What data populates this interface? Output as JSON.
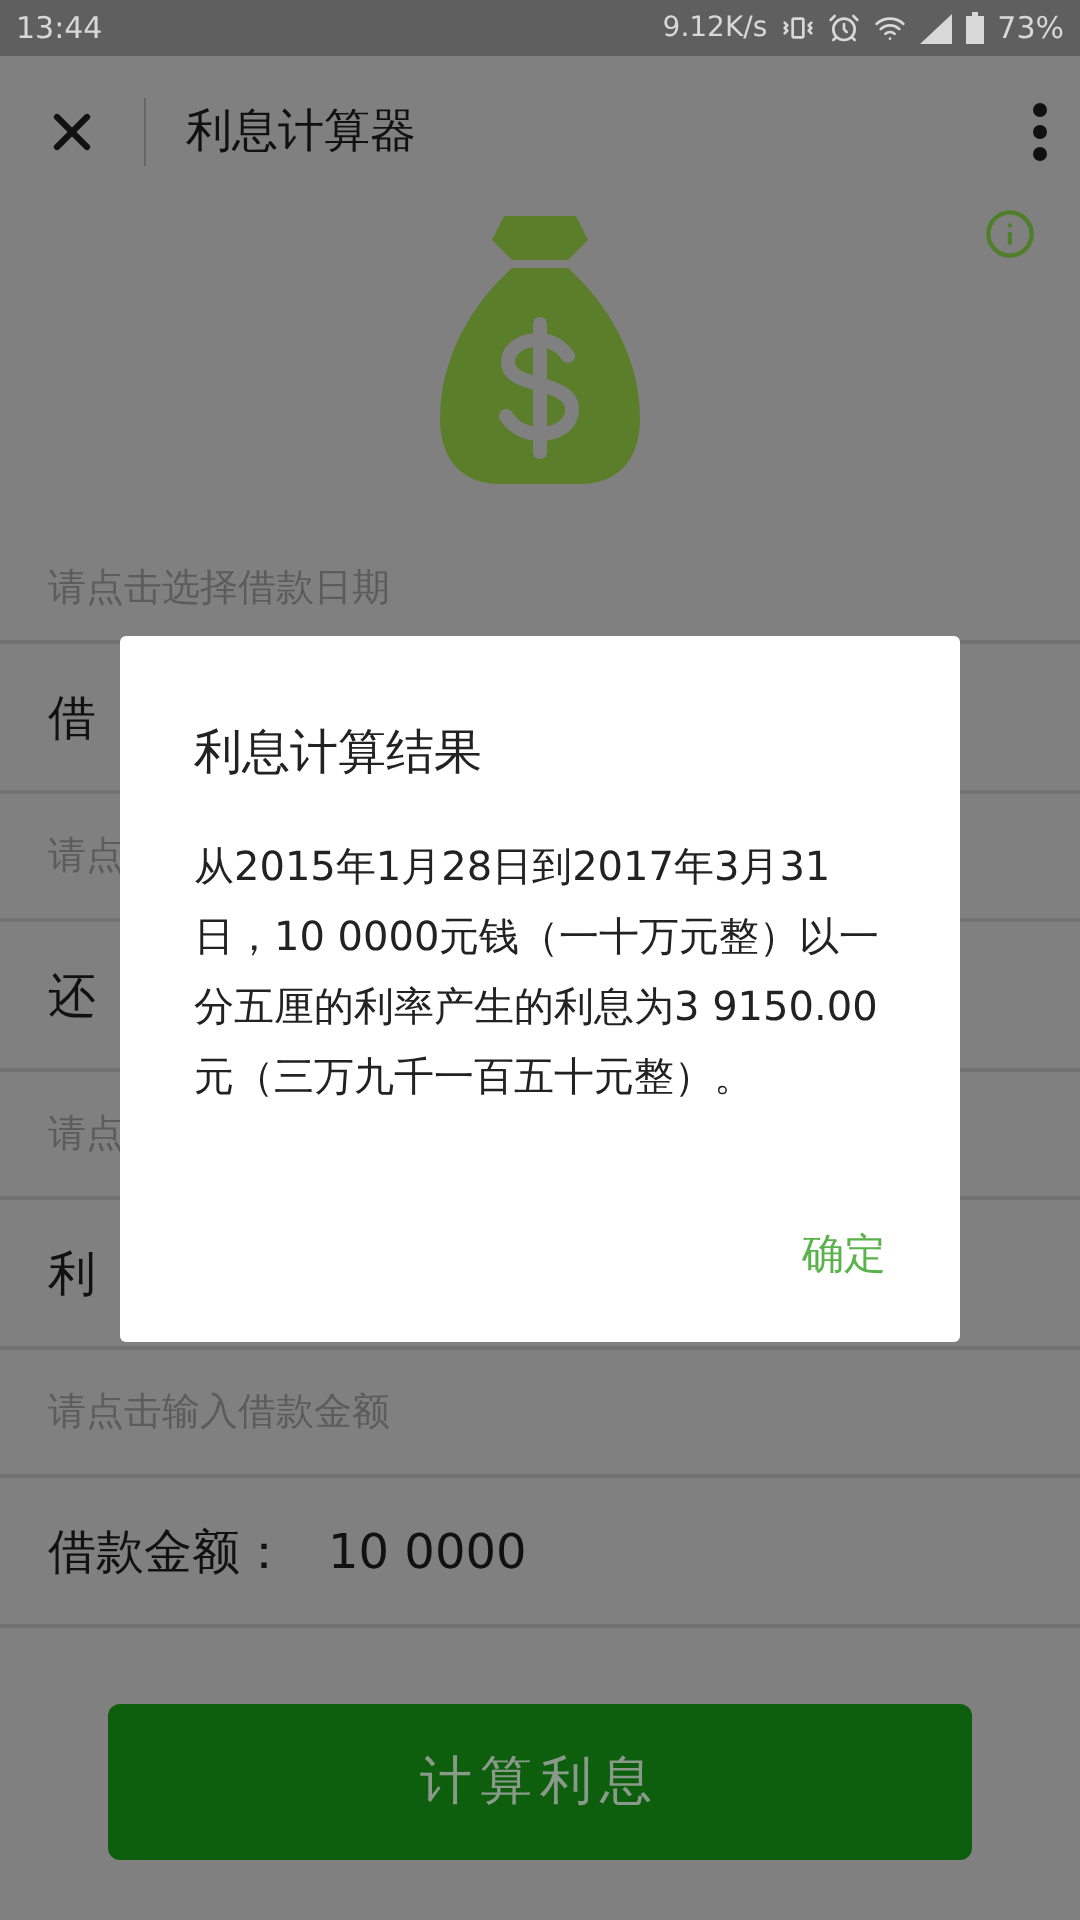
{
  "status_bar": {
    "time": "13:44",
    "speed": "9.12K/s",
    "battery": "73%"
  },
  "header": {
    "title": "利息计算器"
  },
  "form": [
    {
      "hint": "请点击选择借款日期",
      "label": "借"
    },
    {
      "hint": "请点",
      "label": "还"
    },
    {
      "hint": "请点",
      "label": "利"
    },
    {
      "hint": "请点击输入借款金额",
      "label": "借款金额：",
      "amount": "10 0000"
    }
  ],
  "calculate_button": "计算利息",
  "dialog": {
    "title": "利息计算结果",
    "message": "从2015年1月28日到2017年3月31日，10 0000元钱（一十万元整）以一分五厘的利率产生的利息为3 9150.00元（三万九千一百五十元整）。",
    "confirm": "确定"
  }
}
